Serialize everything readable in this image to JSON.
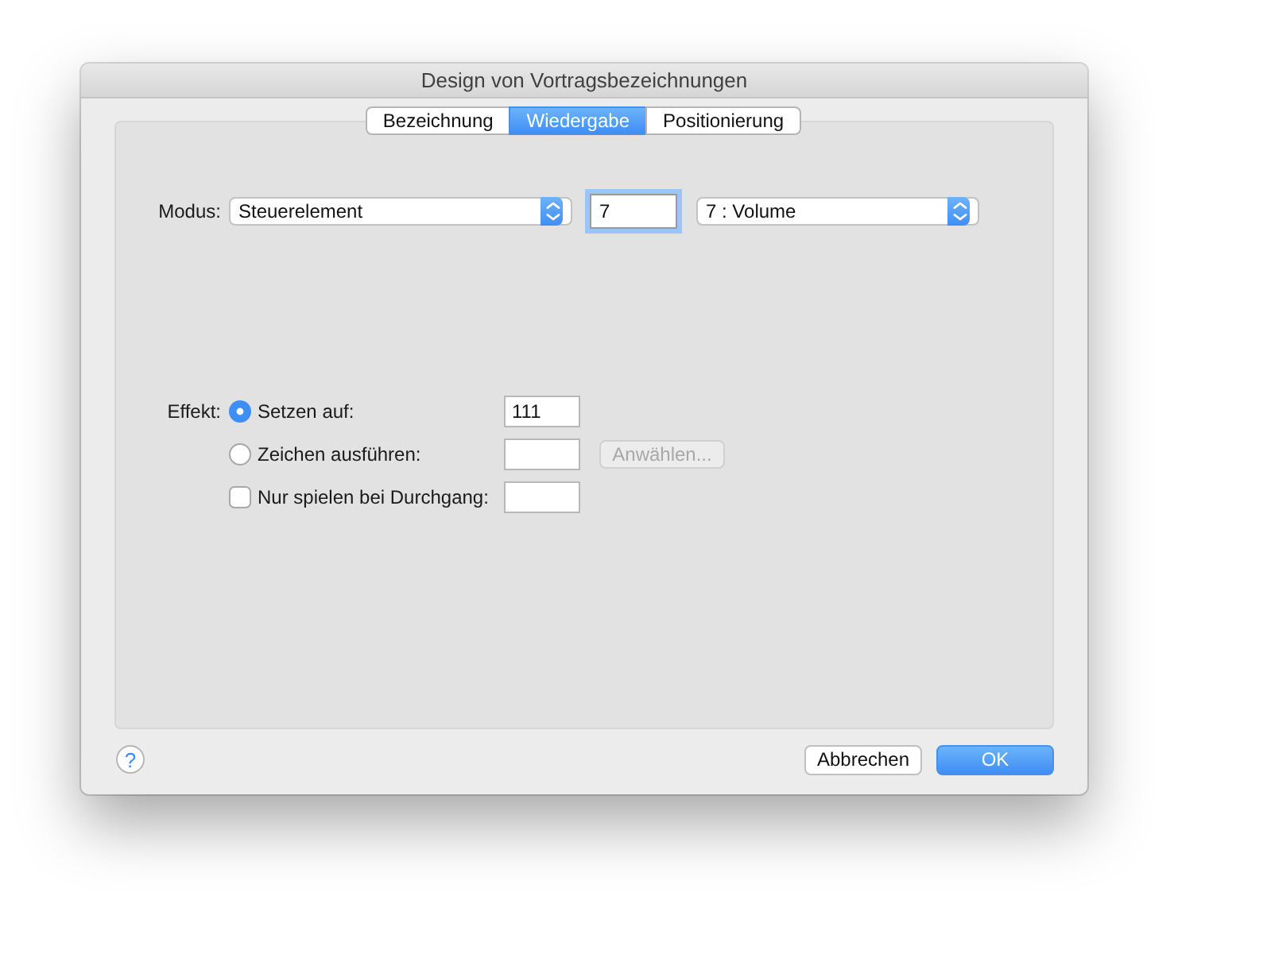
{
  "window": {
    "title": "Design von Vortragsbezeichnungen"
  },
  "tabs": [
    {
      "label": "Bezeichnung",
      "selected": false
    },
    {
      "label": "Wiedergabe",
      "selected": true
    },
    {
      "label": "Positionierung",
      "selected": false
    }
  ],
  "mode": {
    "label": "Modus:",
    "popup": "Steuerelement",
    "number": "7",
    "controller": "7 : Volume"
  },
  "effect": {
    "label": "Effekt:",
    "options": [
      {
        "kind": "radio",
        "label": "Setzen auf:",
        "selected": true,
        "value": "111"
      },
      {
        "kind": "radio",
        "label": "Zeichen ausführen:",
        "selected": false,
        "button": {
          "label": "Anwählen...",
          "disabled": true
        }
      },
      {
        "kind": "checkbox",
        "label": "Nur spielen bei Durchgang:",
        "checked": false
      }
    ]
  },
  "help": "?",
  "buttons": [
    {
      "label": "Abbrechen",
      "default": false
    },
    {
      "label": "OK",
      "default": true
    }
  ]
}
